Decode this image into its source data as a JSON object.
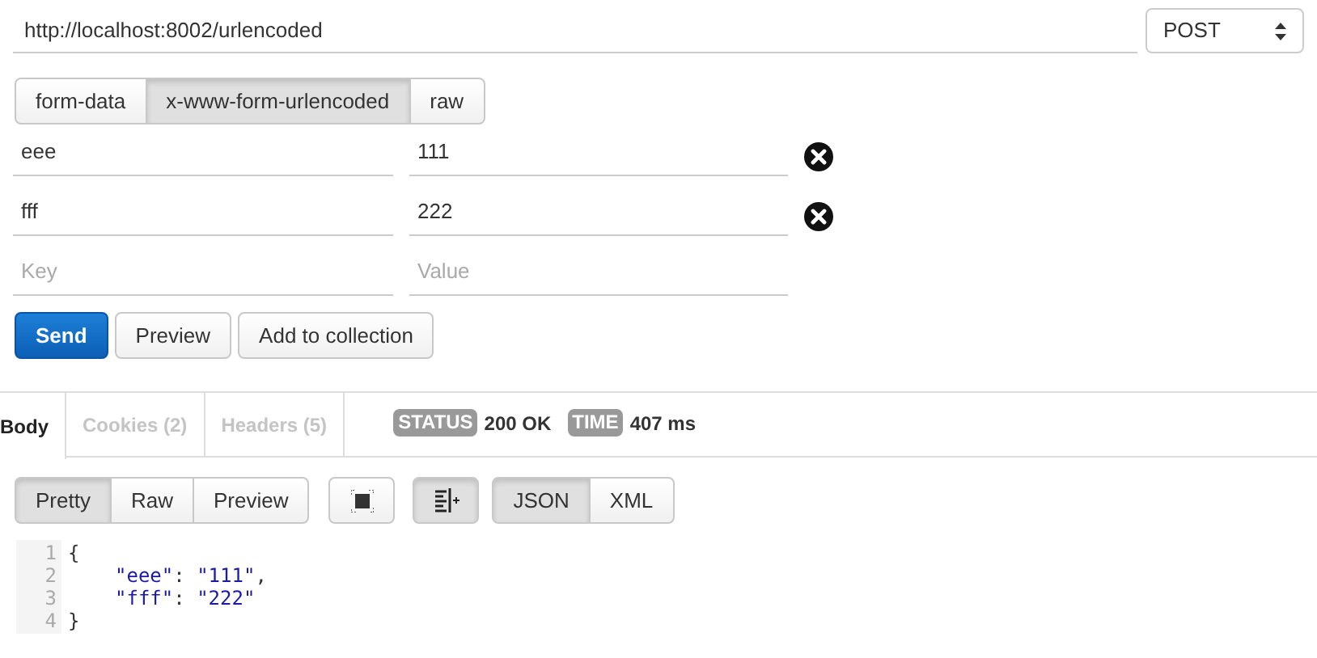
{
  "request": {
    "url": "http://localhost:8002/urlencoded",
    "method": "POST"
  },
  "body_modes": [
    {
      "label": "form-data",
      "selected": false
    },
    {
      "label": "x-www-form-urlencoded",
      "selected": true
    },
    {
      "label": "raw",
      "selected": false
    }
  ],
  "params": [
    {
      "key": "eee",
      "value": "111"
    },
    {
      "key": "fff",
      "value": "222"
    }
  ],
  "new_param": {
    "key_placeholder": "Key",
    "value_placeholder": "Value"
  },
  "actions": [
    {
      "label": "Send",
      "kind": "primary"
    },
    {
      "label": "Preview",
      "kind": "default"
    },
    {
      "label": "Add to collection",
      "kind": "default"
    }
  ],
  "response_tabs": [
    {
      "label": "Body",
      "selected": true
    },
    {
      "label": "Cookies (2)",
      "selected": false
    },
    {
      "label": "Headers (5)",
      "selected": false
    }
  ],
  "status": {
    "label": "STATUS",
    "value": "200 OK"
  },
  "time": {
    "label": "TIME",
    "value": "407 ms"
  },
  "view_modes": [
    {
      "label": "Pretty",
      "selected": true
    },
    {
      "label": "Raw",
      "selected": false
    },
    {
      "label": "Preview",
      "selected": false
    }
  ],
  "tools": [
    {
      "kind": "fullscreen",
      "selected": false
    },
    {
      "kind": "wrap",
      "selected": true
    }
  ],
  "formats": [
    {
      "label": "JSON",
      "selected": true
    },
    {
      "label": "XML",
      "selected": false
    }
  ],
  "code": [
    {
      "number": "1",
      "indented": false,
      "tokens": [
        {
          "kind": "punct",
          "text": "{"
        }
      ]
    },
    {
      "number": "2",
      "indented": true,
      "tokens": [
        {
          "kind": "string",
          "text": "\"eee\""
        },
        {
          "kind": "punct",
          "text": ": "
        },
        {
          "kind": "string",
          "text": "\"111\""
        },
        {
          "kind": "punct",
          "text": ","
        }
      ]
    },
    {
      "number": "3",
      "indented": true,
      "tokens": [
        {
          "kind": "string",
          "text": "\"fff\""
        },
        {
          "kind": "punct",
          "text": ": "
        },
        {
          "kind": "string",
          "text": "\"222\""
        }
      ]
    },
    {
      "number": "4",
      "indented": false,
      "tokens": [
        {
          "kind": "punct",
          "text": "}"
        }
      ]
    }
  ]
}
